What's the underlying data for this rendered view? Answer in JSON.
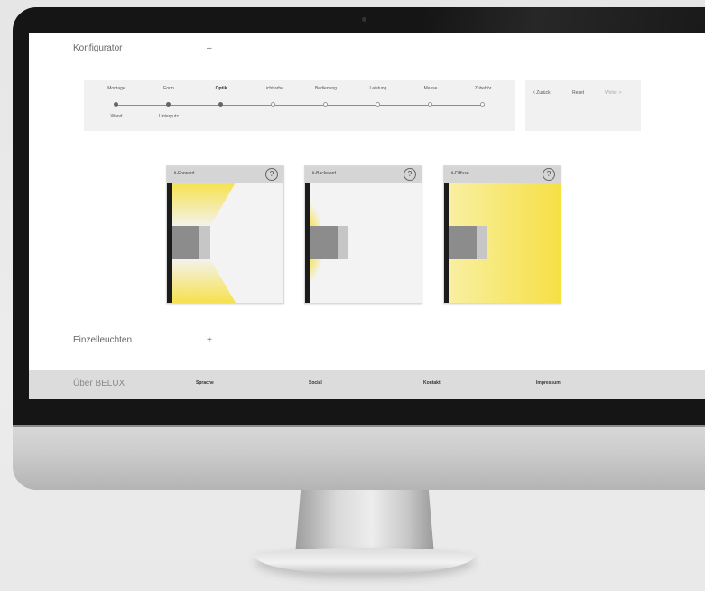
{
  "app": {
    "section_title": "Konfigurator",
    "section_toggle": "–",
    "steps": [
      {
        "label": "Montage",
        "bold": false,
        "sub": "Wand"
      },
      {
        "label": "Form",
        "bold": false,
        "sub": "Unterputz"
      },
      {
        "label": "Optik",
        "bold": true,
        "sub": ""
      },
      {
        "label": "Lichtfarbe",
        "bold": false,
        "sub": ""
      },
      {
        "label": "Bedienung",
        "bold": false,
        "sub": ""
      },
      {
        "label": "Leistung",
        "bold": false,
        "sub": ""
      },
      {
        "label": "Masse",
        "bold": false,
        "sub": ""
      },
      {
        "label": "Zubehör",
        "bold": false,
        "sub": ""
      }
    ],
    "actions": {
      "back": "< Zurück",
      "reset": "Reset",
      "next": "Weiter >"
    },
    "options": [
      {
        "name": "Ⅱ-Forward",
        "help": "?"
      },
      {
        "name": "Ⅱ-Backward",
        "help": "?"
      },
      {
        "name": "Ⅱ-Diffuse",
        "help": "?"
      }
    ],
    "section2_title": "Einzelleuchten",
    "section2_toggle": "+",
    "footer": {
      "about": "Über BELUX",
      "links": [
        "Sprache",
        "Social",
        "Kontakt",
        "Impressum"
      ]
    },
    "colors": {
      "accent_yellow": "#f6e045",
      "bar": "#f1f1f1",
      "footer": "#dcdcdc"
    }
  }
}
